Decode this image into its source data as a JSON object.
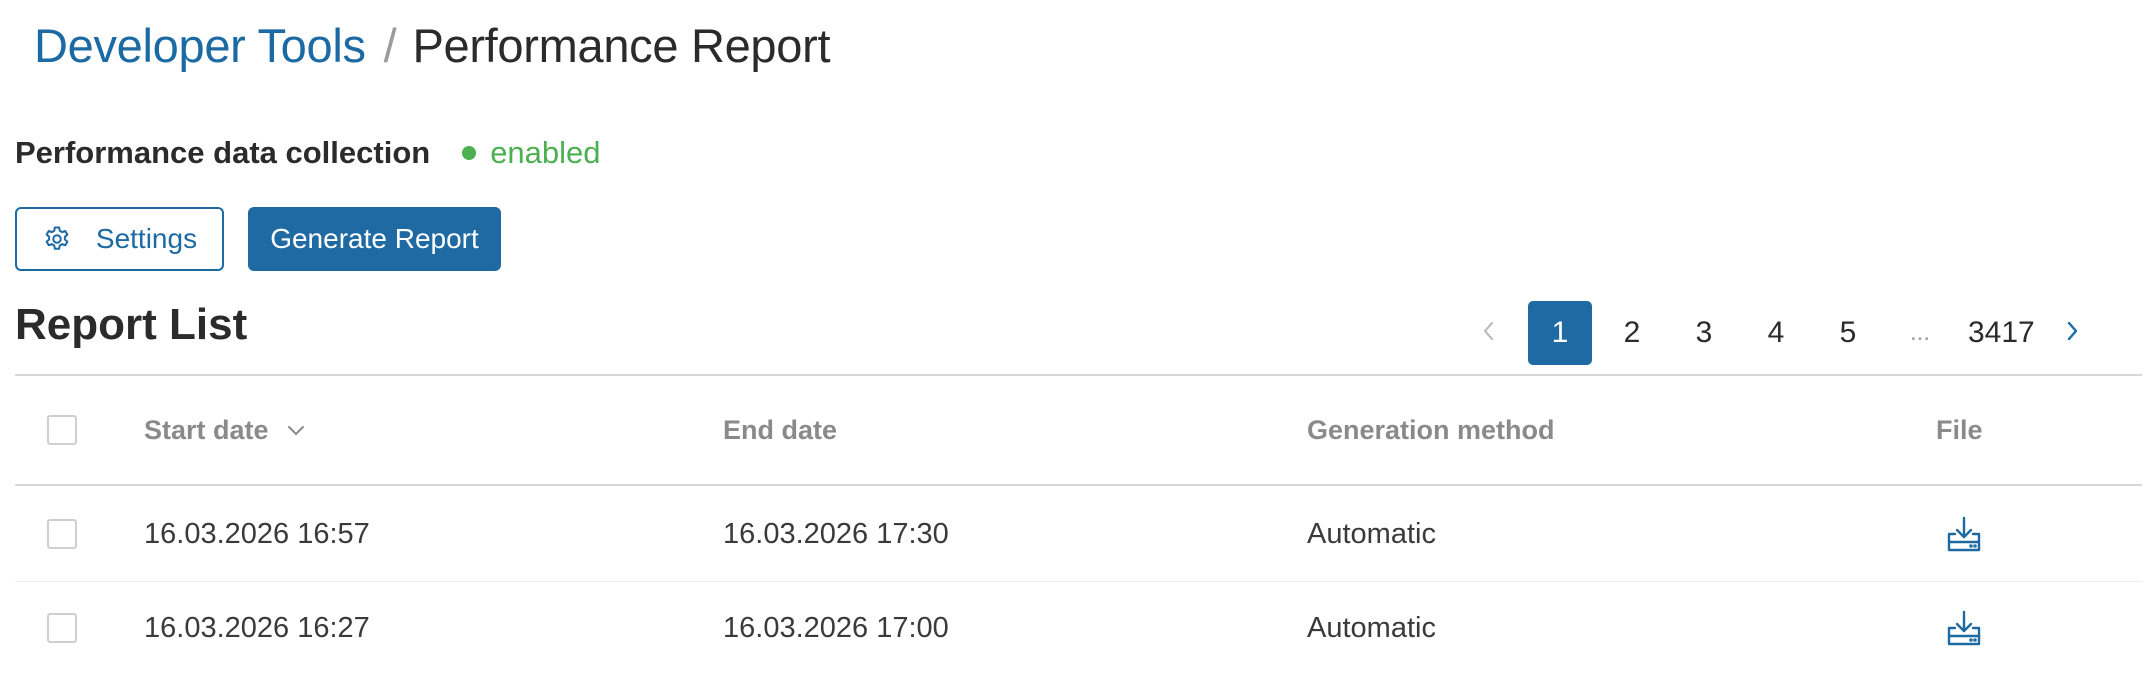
{
  "breadcrumb": {
    "parent": "Developer Tools",
    "separator": "/",
    "current": "Performance Report"
  },
  "status": {
    "label": "Performance data collection",
    "value": "enabled",
    "color": "#4caf50"
  },
  "actions": {
    "settings_label": "Settings",
    "generate_label": "Generate Report"
  },
  "report_list": {
    "title": "Report List"
  },
  "pagination": {
    "pages": [
      "1",
      "2",
      "3",
      "4",
      "5"
    ],
    "ellipsis": "...",
    "last": "3417",
    "current": "1"
  },
  "table": {
    "columns": {
      "start_date": "Start date",
      "end_date": "End date",
      "method": "Generation method",
      "file": "File"
    },
    "rows": [
      {
        "start": "16.03.2026 16:57",
        "end": "16.03.2026 17:30",
        "method": "Automatic",
        "file_icon": "download-icon"
      },
      {
        "start": "16.03.2026 16:27",
        "end": "16.03.2026 17:00",
        "method": "Automatic",
        "file_icon": "download-icon"
      }
    ]
  },
  "colors": {
    "accent": "#1f6aa3",
    "link": "#1c6aa3",
    "success": "#4caf50",
    "muted": "#8a8a8a"
  }
}
